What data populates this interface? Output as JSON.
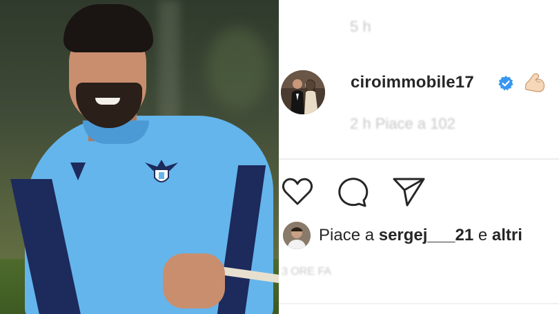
{
  "post": {
    "timestamp_top": "5 h",
    "username": "ciroimmobile17",
    "verified_icon": "verified-badge-icon",
    "emoji_icon": "flexed-biceps-icon",
    "meta_line": "2 h  Piace a 102",
    "likes_prefix": "Piace a ",
    "liker_username": "sergej___21",
    "likes_suffix": " e altri",
    "bottom_text": "3 ORE FA"
  },
  "actions": {
    "like_icon": "heart-icon",
    "comment_icon": "comment-icon",
    "share_icon": "send-icon"
  },
  "colors": {
    "verified_blue": "#3897f0",
    "text_primary": "#262626",
    "shirt_blue": "#64b5ec"
  }
}
